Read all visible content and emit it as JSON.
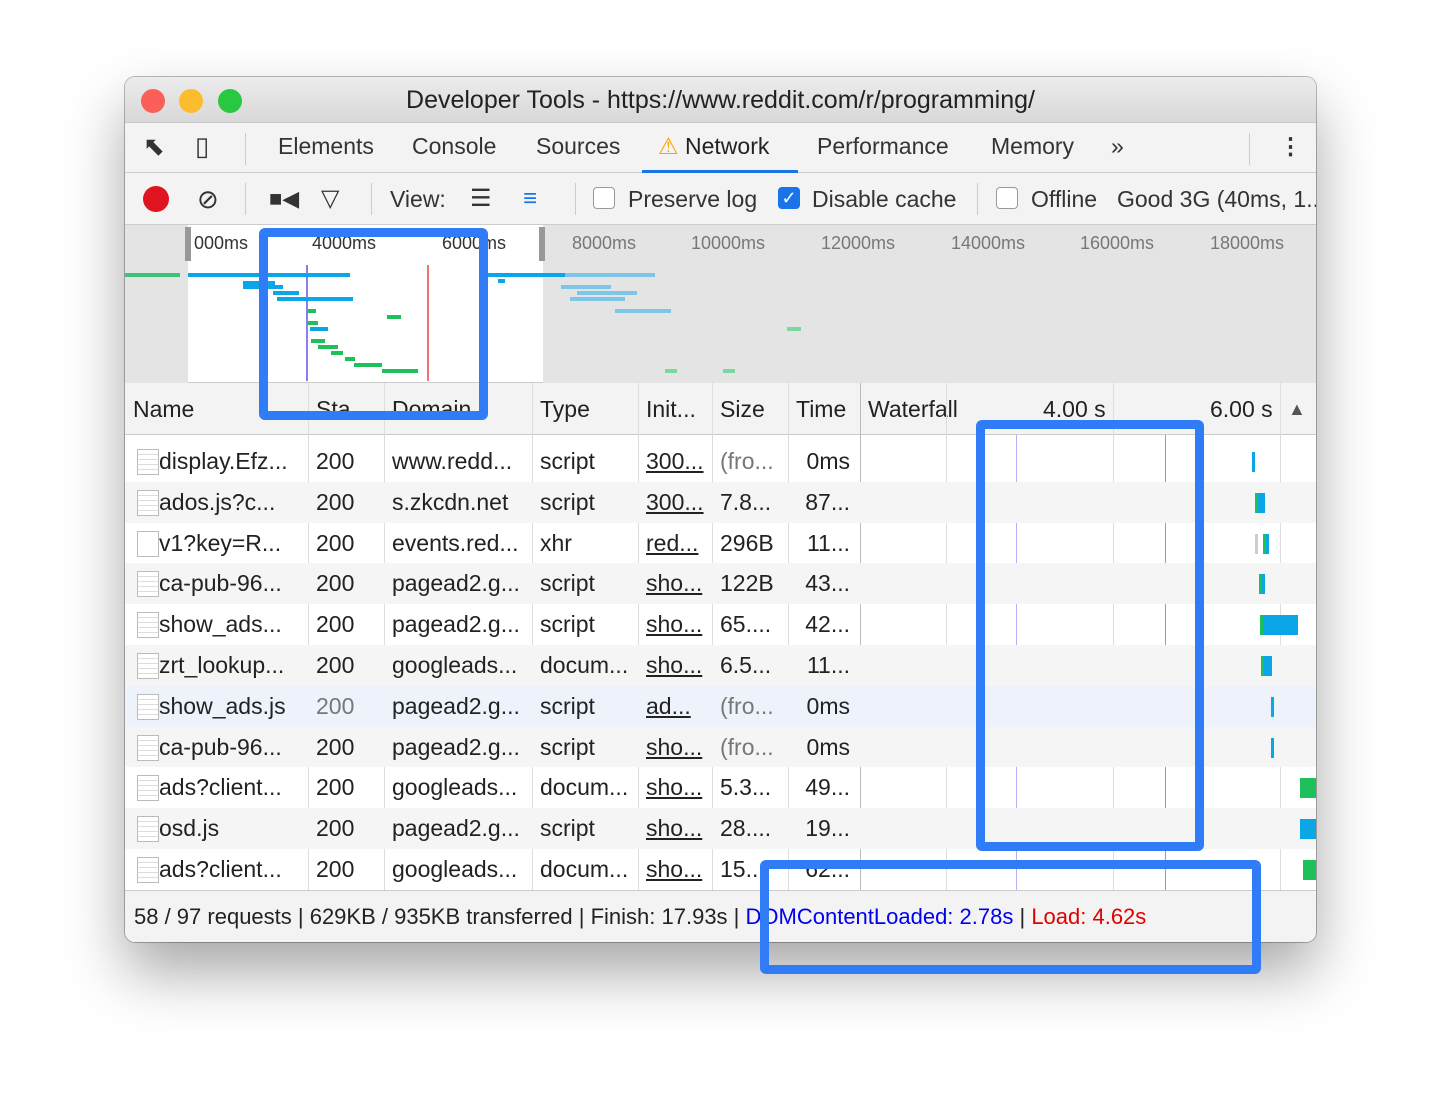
{
  "window": {
    "title": "Developer Tools - https://www.reddit.com/r/programming/"
  },
  "tabs": [
    {
      "label": "Elements"
    },
    {
      "label": "Console"
    },
    {
      "label": "Sources"
    },
    {
      "label": "Network",
      "active": true,
      "icon": "warning-icon"
    },
    {
      "label": "Performance"
    },
    {
      "label": "Memory"
    }
  ],
  "toolbar": {
    "view_label": "View:",
    "preserve_log": "Preserve log",
    "preserve_log_checked": false,
    "disable_cache": "Disable cache",
    "disable_cache_checked": true,
    "offline": "Offline",
    "offline_checked": false,
    "throttle": "Good 3G (40ms, 1..."
  },
  "overview": {
    "ticks": [
      "000ms",
      "4000ms",
      "6000ms",
      "8000ms",
      "10000ms",
      "12000ms",
      "14000ms",
      "16000ms",
      "18000ms"
    ]
  },
  "columns": {
    "name": "Name",
    "status": "Sta...",
    "domain": "Domain",
    "type": "Type",
    "initiator": "Init...",
    "size": "Size",
    "time": "Time",
    "waterfall": "Waterfall",
    "wf_tick1": "4.00 s",
    "wf_tick2": "6.00 s",
    "sort": "ascending"
  },
  "rows": [
    {
      "name": "display.Efz...",
      "status": "200",
      "domain": "www.redd...",
      "type": "script",
      "initiator": "300...",
      "size": "(fro...",
      "time": "0ms"
    },
    {
      "name": "ados.js?c...",
      "status": "200",
      "domain": "s.zkcdn.net",
      "type": "script",
      "initiator": "300...",
      "size": "7.8...",
      "time": "87..."
    },
    {
      "name": "v1?key=R...",
      "status": "200",
      "domain": "events.red...",
      "type": "xhr",
      "initiator": "red...",
      "size": "296B",
      "time": "11..."
    },
    {
      "name": "ca-pub-96...",
      "status": "200",
      "domain": "pagead2.g...",
      "type": "script",
      "initiator": "sho...",
      "size": "122B",
      "time": "43..."
    },
    {
      "name": "show_ads...",
      "status": "200",
      "domain": "pagead2.g...",
      "type": "script",
      "initiator": "sho...",
      "size": "65....",
      "time": "42..."
    },
    {
      "name": "zrt_lookup...",
      "status": "200",
      "domain": "googleads...",
      "type": "docum...",
      "initiator": "sho...",
      "size": "6.5...",
      "time": "11..."
    },
    {
      "name": "show_ads.js",
      "status": "200",
      "domain": "pagead2.g...",
      "type": "script",
      "initiator": "ad...",
      "size": "(fro...",
      "time": "0ms"
    },
    {
      "name": "ca-pub-96...",
      "status": "200",
      "domain": "pagead2.g...",
      "type": "script",
      "initiator": "sho...",
      "size": "(fro...",
      "time": "0ms"
    },
    {
      "name": "ads?client...",
      "status": "200",
      "domain": "googleads...",
      "type": "docum...",
      "initiator": "sho...",
      "size": "5.3...",
      "time": "49..."
    },
    {
      "name": "osd.js",
      "status": "200",
      "domain": "pagead2.g...",
      "type": "script",
      "initiator": "sho...",
      "size": "28....",
      "time": "19..."
    },
    {
      "name": "ads?client...",
      "status": "200",
      "domain": "googleads...",
      "type": "docum...",
      "initiator": "sho...",
      "size": "15...",
      "time": "62..."
    }
  ],
  "status_bar": {
    "summary": "58 / 97 requests | 629KB / 935KB transferred | Finish: 17.93s",
    "sep": " | ",
    "dcl": "DOMContentLoaded: 2.78s",
    "sep2": " | ",
    "load": "Load: 4.62s"
  },
  "colors": {
    "accent": "#1a73e8",
    "dcl": "#0000ee",
    "load": "#e00000",
    "highlight": "#2f7cf6"
  }
}
